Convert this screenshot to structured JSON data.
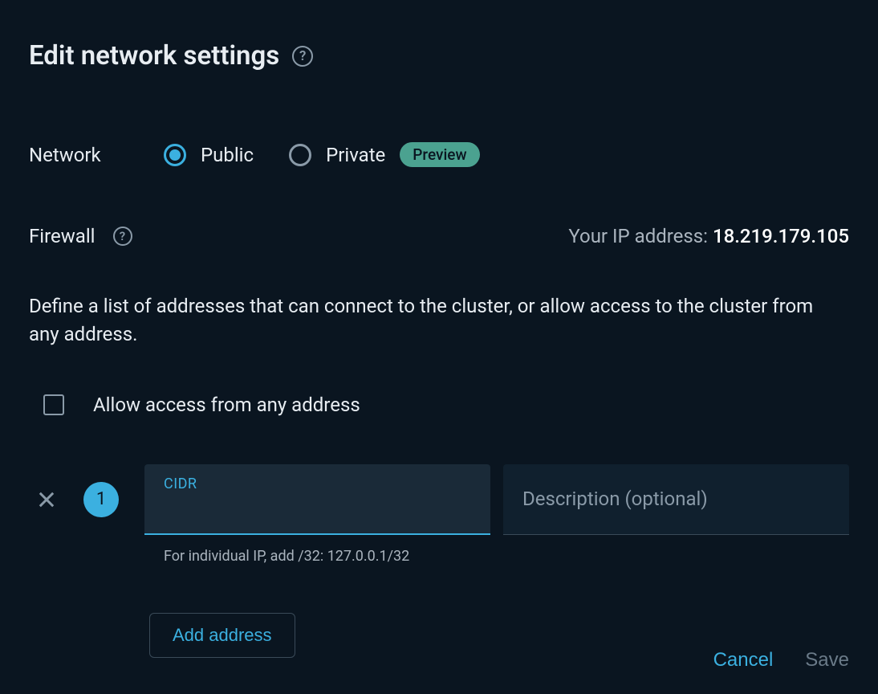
{
  "header": {
    "title": "Edit network settings"
  },
  "network": {
    "label": "Network",
    "options": {
      "public": "Public",
      "private": "Private"
    },
    "preview_badge": "Preview"
  },
  "firewall": {
    "label": "Firewall",
    "ip_label": "Your IP address: ",
    "ip_value": "18.219.179.105",
    "description": "Define a list of addresses that can connect to the cluster, or allow access to the cluster from any address.",
    "allow_any_label": "Allow access from any address"
  },
  "address_entry": {
    "number": "1",
    "cidr_label": "CIDR",
    "cidr_helper": "For individual IP, add /32: 127.0.0.1/32",
    "description_placeholder": "Description (optional)"
  },
  "buttons": {
    "add_address": "Add address",
    "cancel": "Cancel",
    "save": "Save"
  }
}
